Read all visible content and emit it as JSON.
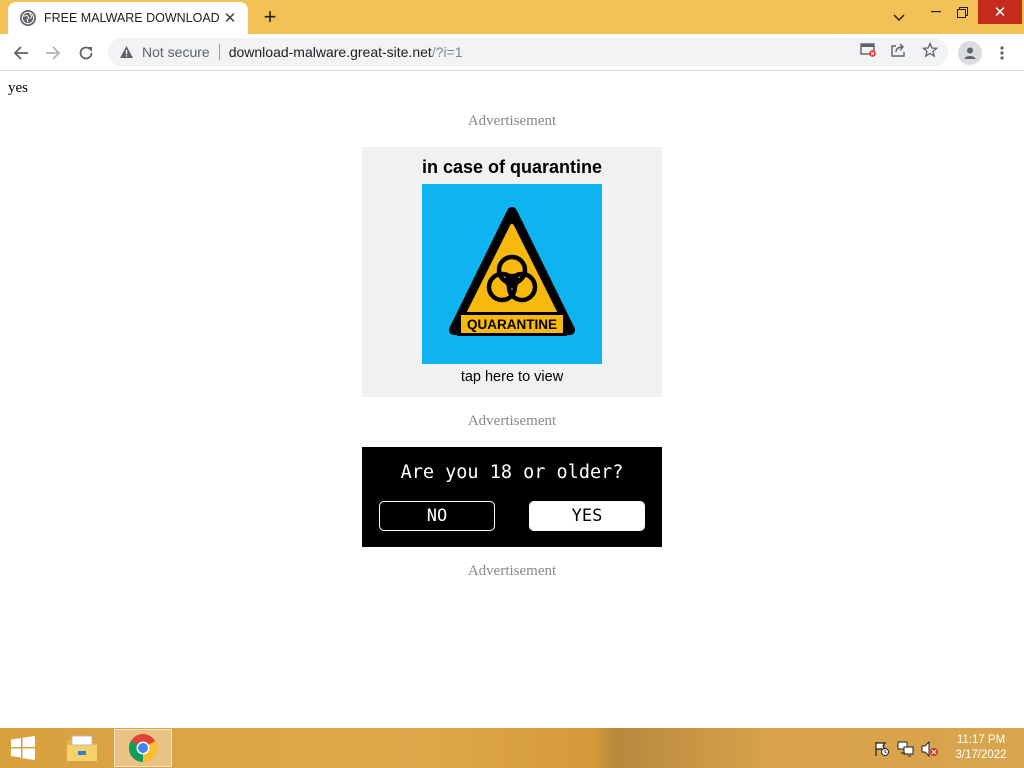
{
  "browser": {
    "tab_title": "FREE MALWARE DOWNLOAD",
    "security_label": "Not secure",
    "url_host": "download-malware.great-site.net",
    "url_path": "/?i=1"
  },
  "page": {
    "top_text": "yes",
    "ad_label": "Advertisement",
    "quarantine_ad": {
      "heading": "in case of quarantine",
      "sign_text": "QUARANTINE",
      "caption": "tap here to view"
    },
    "age_check": {
      "question": "Are you 18 or older?",
      "no_label": "NO",
      "yes_label": "YES"
    }
  },
  "taskbar": {
    "time": "11:17 PM",
    "date": "3/17/2022"
  },
  "colors": {
    "tabstrip": "#f2c256",
    "close_button": "#c42b1c",
    "ad_image_background": "#0db4f0",
    "sign_yellow": "#f7b90b",
    "age_box": "#000000"
  },
  "icons": [
    "globe-icon",
    "close-icon",
    "plus-icon",
    "chevron-down-icon",
    "minimize-icon",
    "restore-icon",
    "back-arrow-icon",
    "forward-arrow-icon",
    "reload-icon",
    "warning-icon",
    "cast-blocked-icon",
    "share-icon",
    "star-icon",
    "profile-icon",
    "more-vert-icon",
    "windows-logo-icon",
    "file-explorer-icon",
    "chrome-icon",
    "flag-icon",
    "network-icon",
    "volume-muted-icon",
    "biohazard-icon"
  ]
}
